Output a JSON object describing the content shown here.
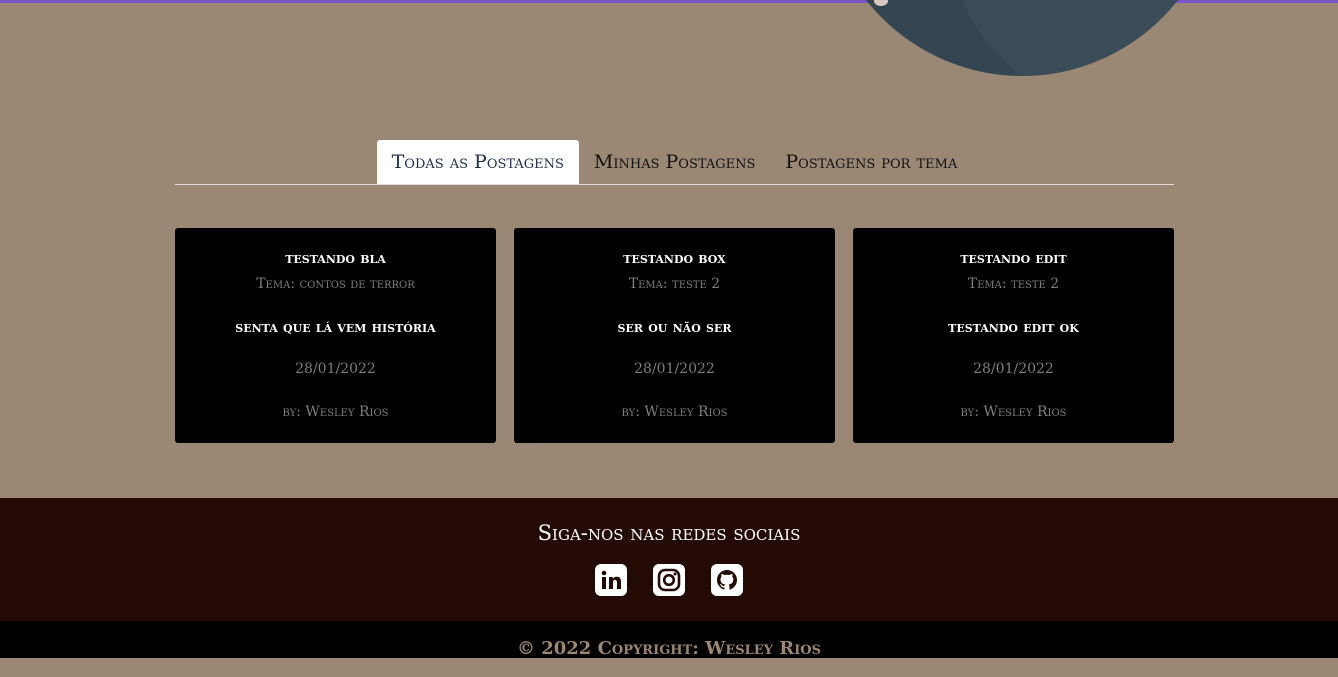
{
  "tabs": [
    {
      "label": "Todas as Postagens",
      "active": true
    },
    {
      "label": "Minhas Postagens",
      "active": false
    },
    {
      "label": "Postagens por tema",
      "active": false
    }
  ],
  "posts": [
    {
      "title": "testando bla",
      "tema": "Tema: contos de terror",
      "text": "senta que lá vem história",
      "date": "28/01/2022",
      "author": "by: Wesley Rios"
    },
    {
      "title": "testando box",
      "tema": "Tema: teste 2",
      "text": "ser ou não ser",
      "date": "28/01/2022",
      "author": "by: Wesley Rios"
    },
    {
      "title": "testando edit",
      "tema": "Tema: teste 2",
      "text": "testando edit ok",
      "date": "28/01/2022",
      "author": "by: Wesley Rios"
    }
  ],
  "footer": {
    "title": "Siga-nos nas redes sociais",
    "socials": [
      "linkedin-icon",
      "instagram-icon",
      "github-icon"
    ],
    "copyright": "© 2022 Copyright: Wesley Rios"
  },
  "colors": {
    "background": "#9a8774",
    "footer": "#230a05",
    "card": "#000000",
    "accent": "#7a55c8"
  }
}
